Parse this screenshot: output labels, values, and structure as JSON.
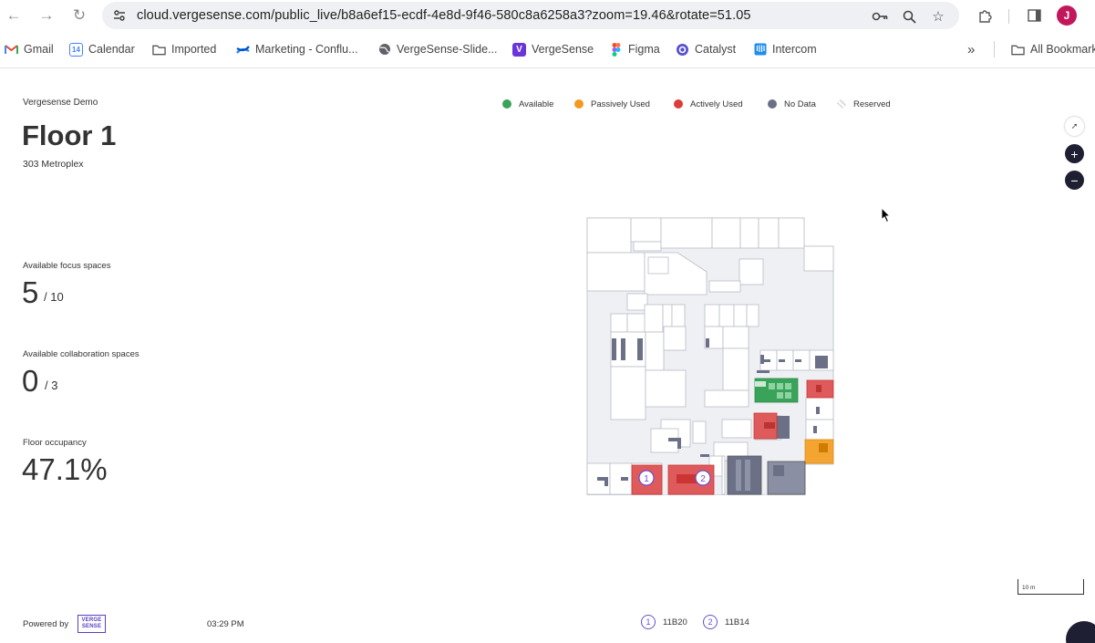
{
  "browser": {
    "url": "cloud.vergesense.com/public_live/b8a6ef15-ecdf-4e8d-9f46-580c8a6258a3?zoom=19.46&rotate=51.05",
    "avatar_initial": "J",
    "bookmarks": [
      {
        "label": "Gmail",
        "icon": "gmail-icon"
      },
      {
        "label": "Calendar",
        "icon": "calendar-icon"
      },
      {
        "label": "Imported",
        "icon": "folder-icon"
      },
      {
        "label": "Marketing - Conflu...",
        "icon": "confluence-icon"
      },
      {
        "label": "VergeSense-Slide...",
        "icon": "globe-icon"
      },
      {
        "label": "VergeSense",
        "icon": "vergesense-icon"
      },
      {
        "label": "Figma",
        "icon": "figma-icon"
      },
      {
        "label": "Catalyst",
        "icon": "catalyst-icon"
      },
      {
        "label": "Intercom",
        "icon": "intercom-icon"
      }
    ],
    "all_bookmarks_label": "All Bookmarks",
    "calendar_day": "14"
  },
  "header": {
    "org": "Vergesense Demo",
    "floor": "Floor 1",
    "address": "303 Metroplex"
  },
  "legend": [
    {
      "label": "Available",
      "color": "#3aa35a"
    },
    {
      "label": "Passively Used",
      "color": "#f29a1f"
    },
    {
      "label": "Actively Used",
      "color": "#df3b3b"
    },
    {
      "label": "No Data",
      "color": "#6b7087"
    },
    {
      "label": "Reserved",
      "color": "#d8d8d8"
    }
  ],
  "stats": {
    "focus": {
      "label": "Available focus spaces",
      "value": "5",
      "total": "/ 10"
    },
    "collab": {
      "label": "Available collaboration spaces",
      "value": "0",
      "total": "/ 3"
    },
    "occupancy": {
      "label": "Floor occupancy",
      "value": "47.1%"
    }
  },
  "map": {
    "scale_label": "10 m",
    "badges": [
      {
        "number": "1",
        "room": "11B20"
      },
      {
        "number": "2",
        "room": "11B14"
      }
    ]
  },
  "footer": {
    "powered_by": "Powered by",
    "logo_text": "VERGE SENSE",
    "time": "03:29 PM"
  }
}
